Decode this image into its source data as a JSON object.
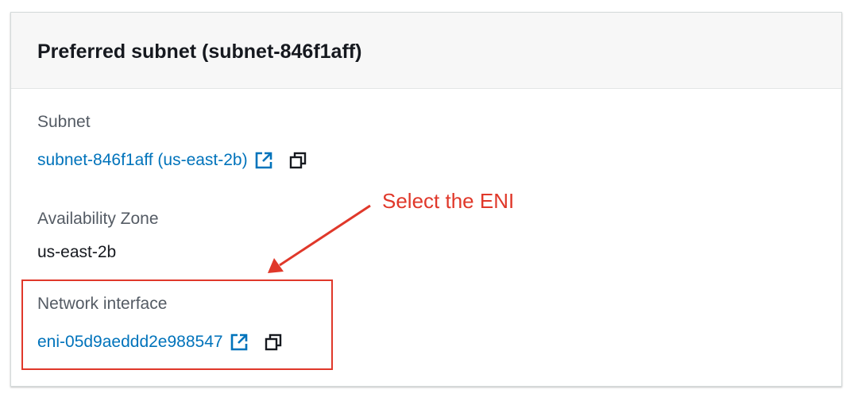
{
  "panel": {
    "title": "Preferred subnet (subnet-846f1aff)"
  },
  "subnet": {
    "label": "Subnet",
    "link_text": "subnet-846f1aff (us-east-2b)",
    "external_icon": "external-link-icon",
    "copy_icon": "copy-icon"
  },
  "availability_zone": {
    "label": "Availability Zone",
    "value": "us-east-2b"
  },
  "network_interface": {
    "label": "Network interface",
    "link_text": "eni-05d9aeddd2e988547",
    "external_icon": "external-link-icon",
    "copy_icon": "copy-icon"
  },
  "annotation": {
    "text": "Select the ENI",
    "color": "#e0382a"
  },
  "colors": {
    "link": "#0073bb",
    "label": "#545b64",
    "text": "#16191f",
    "header_bg": "#f7f7f7"
  }
}
